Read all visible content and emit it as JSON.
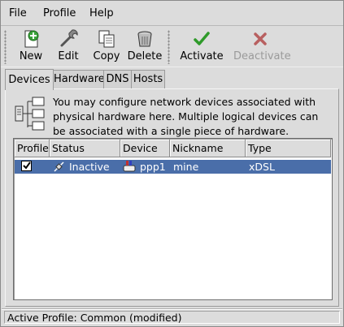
{
  "menubar": {
    "file": "File",
    "profile": "Profile",
    "help": "Help"
  },
  "toolbar": {
    "new": "New",
    "edit": "Edit",
    "copy": "Copy",
    "delete": "Delete",
    "activate": "Activate",
    "deactivate": "Deactivate"
  },
  "tabs": [
    "Devices",
    "Hardware",
    "DNS",
    "Hosts"
  ],
  "info_text": "You may configure network devices associated with physical hardware here.  Multiple logical devices can be associated with a single piece of hardware.",
  "table": {
    "headers": [
      "Profile",
      "Status",
      "Device",
      "Nickname",
      "Type"
    ],
    "rows": [
      {
        "profile_checked": true,
        "status": "Inactive",
        "device": "ppp1",
        "nickname": "mine",
        "type": "xDSL"
      }
    ]
  },
  "statusbar": "Active Profile: Common (modified)",
  "colors": {
    "selection": "#4a6ea9",
    "background": "#dcdcdc",
    "new_icon": "#2f9a2a",
    "activate_icon": "#2f9a2a",
    "deactivate_icon": "#b04040"
  },
  "icons": {
    "new": "new-document-icon",
    "edit": "wrench-icon",
    "copy": "copy-documents-icon",
    "delete": "trash-can-icon",
    "activate": "green-check-icon",
    "deactivate": "red-x-icon",
    "network": "network-devices-icon",
    "status_inactive": "disconnected-plug-icon",
    "device": "modem-icon"
  }
}
